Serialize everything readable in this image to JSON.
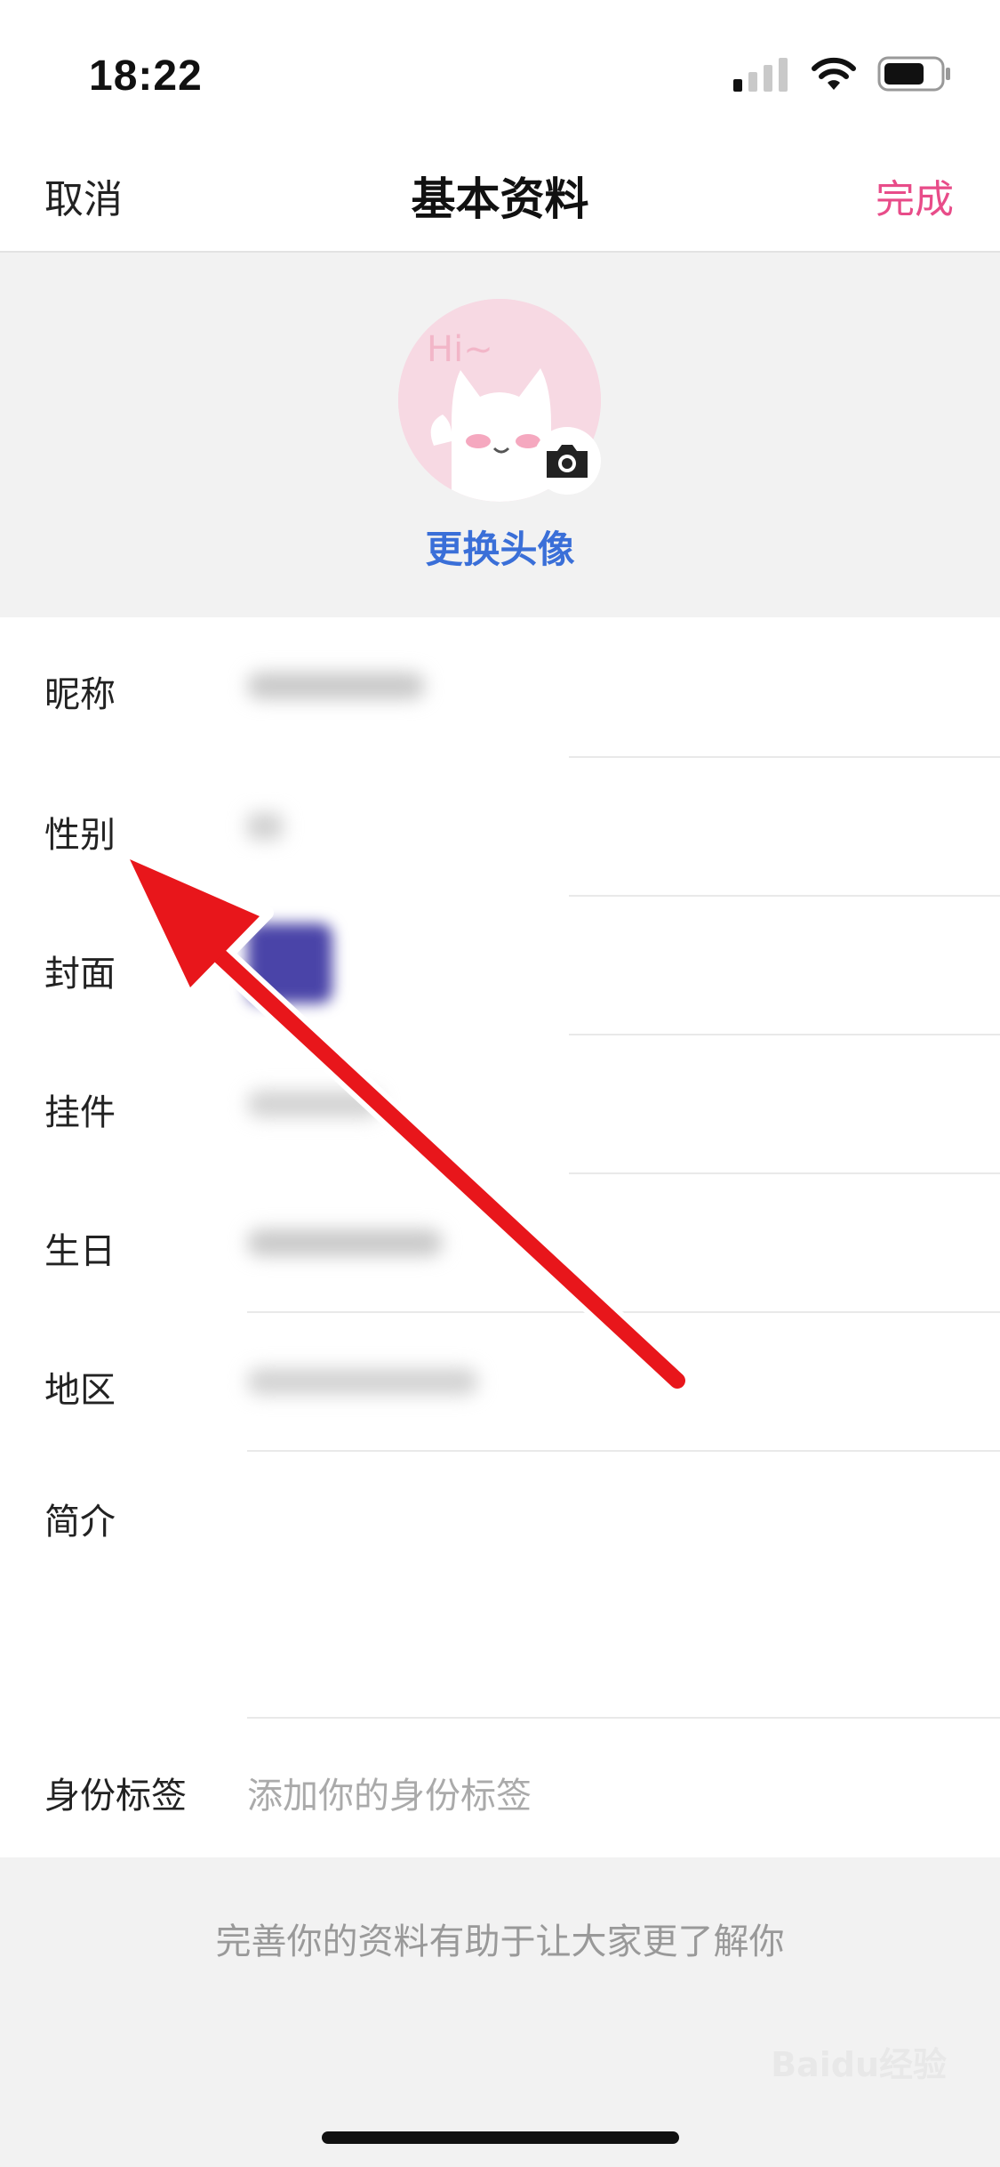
{
  "status_bar": {
    "time": "18:22"
  },
  "navbar": {
    "cancel": "取消",
    "title": "基本资料",
    "done": "完成"
  },
  "avatar": {
    "change_label": "更换头像",
    "avatar_text": "Hi~"
  },
  "form": {
    "rows": [
      {
        "label": "昵称",
        "value": ""
      },
      {
        "label": "性别",
        "value": ""
      },
      {
        "label": "封面",
        "value": ""
      },
      {
        "label": "挂件",
        "value": ""
      },
      {
        "label": "生日",
        "value": ""
      },
      {
        "label": "地区",
        "value": ""
      },
      {
        "label": "简介",
        "value": ""
      }
    ],
    "identity": {
      "label": "身份标签",
      "placeholder": "添加你的身份标签"
    }
  },
  "footer": {
    "note": "完善你的资料有助于让大家更了解你"
  },
  "watermark": "Baidu经验",
  "colors": {
    "accent_done": "#e84c89",
    "link_blue": "#3a6fd8",
    "arrow_red": "#e8161b"
  }
}
